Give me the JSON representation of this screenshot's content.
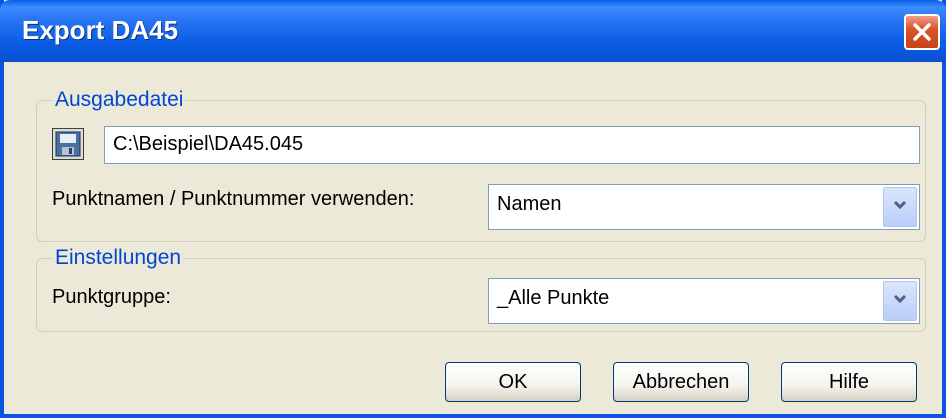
{
  "window": {
    "title": "Export DA45"
  },
  "output_group": {
    "legend": "Ausgabedatei",
    "file_path": "C:\\Beispiel\\DA45.045",
    "name_label": "Punktnamen / Punktnummer verwenden:",
    "name_value": "Namen"
  },
  "settings_group": {
    "legend": "Einstellungen",
    "group_label": "Punktgruppe:",
    "group_value": "_Alle Punkte"
  },
  "buttons": {
    "ok": "OK",
    "cancel": "Abbrechen",
    "help": "Hilfe"
  },
  "icons": [
    "close-icon",
    "save-disk-icon",
    "chevron-down-icon"
  ]
}
